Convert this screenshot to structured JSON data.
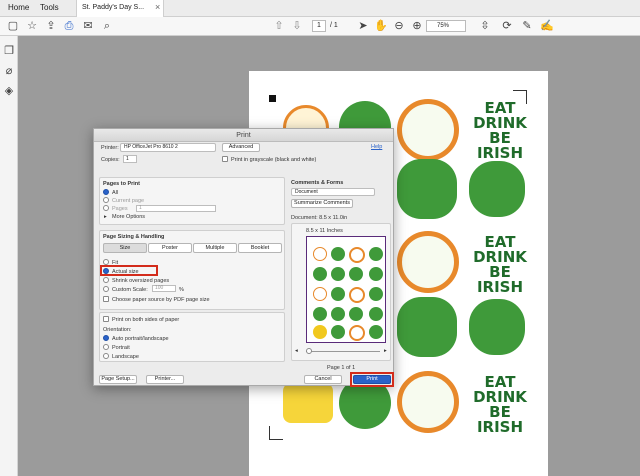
{
  "tabs": {
    "home": "Home",
    "tools": "Tools",
    "document": "St. Paddy's Day S...",
    "close": "×"
  },
  "toolbar": {
    "page_current": "1",
    "page_total": "/ 1",
    "zoom": "75%"
  },
  "dialog": {
    "title": "Print",
    "help": "Help",
    "printer_label": "Printer:",
    "printer_value": "HP OfficeJet Pro 8610 2",
    "advanced": "Advanced",
    "copies_label": "Copies:",
    "copies_value": "1",
    "grayscale": "Print in grayscale (black and white)",
    "pages_section": "Pages to Print",
    "all": "All",
    "current_page": "Current page",
    "pages": "Pages",
    "pages_value": "1",
    "more_options": "More Options",
    "sizing_section": "Page Sizing & Handling",
    "size_tabs": [
      "Size",
      "Poster",
      "Multiple",
      "Booklet"
    ],
    "fit": "Fit",
    "actual_size": "Actual size",
    "shrink": "Shrink oversized pages",
    "custom_scale": "Custom Scale:",
    "custom_scale_value": "100",
    "percent": "%",
    "paper_source": "Choose paper source by PDF page size",
    "both_sides": "Print on both sides of paper",
    "orientation": "Orientation:",
    "auto": "Auto portrait/landscape",
    "portrait": "Portrait",
    "landscape": "Landscape",
    "comments_section": "Comments & Forms",
    "comments_value": "Document",
    "summarize": "Summarize Comments",
    "doc_size": "Document: 8.5 x 11.0in",
    "preview_size": "8.5 x 11 Inches",
    "page_of": "Page 1 of 1",
    "page_setup": "Page Setup...",
    "printer_btn": "Printer...",
    "cancel": "Cancel",
    "print": "Print"
  },
  "colors": {
    "orange": "#e8892b",
    "green": "#3f9a3a",
    "dark_green": "#1f6b2a",
    "yellow": "#f1c81e",
    "blue": "#2a62c9",
    "red": "#d32b1b"
  }
}
